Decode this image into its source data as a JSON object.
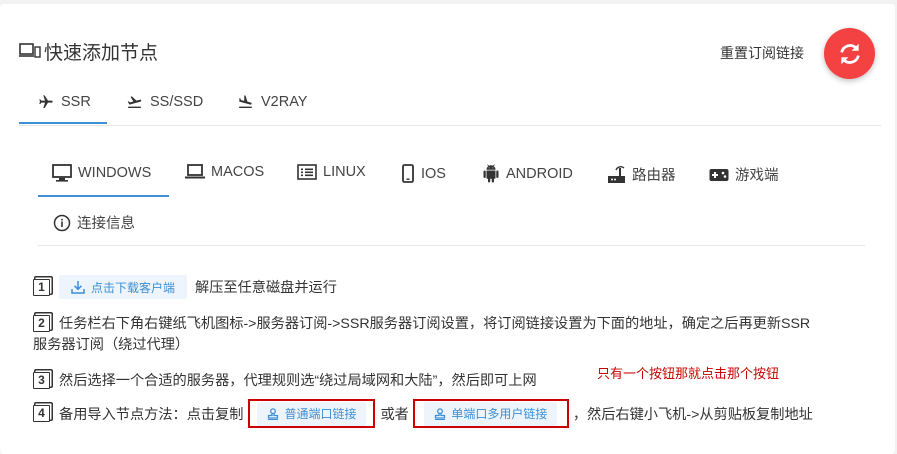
{
  "header": {
    "title": "快速添加节点",
    "reset_label": "重置订阅链接"
  },
  "protocol_tabs": [
    {
      "label": "SSR",
      "active": true
    },
    {
      "label": "SS/SSD",
      "active": false
    },
    {
      "label": "V2RAY",
      "active": false
    }
  ],
  "os_tabs": [
    {
      "label": "WINDOWS",
      "active": true
    },
    {
      "label": "MACOS",
      "active": false
    },
    {
      "label": "LINUX",
      "active": false
    },
    {
      "label": "IOS",
      "active": false
    },
    {
      "label": "ANDROID",
      "active": false
    },
    {
      "label": "路由器",
      "active": false
    },
    {
      "label": "游戏端",
      "active": false
    },
    {
      "label": "连接信息",
      "active": false
    }
  ],
  "steps": {
    "s1_num": "1",
    "s1_button": "点击下载客户端",
    "s1_text": "解压至任意磁盘并运行",
    "s2_num": "2",
    "s2_line1": "任务栏右下角右键纸飞机图标->服务器订阅->SSR服务器订阅设置，将订阅链接设置为下面的地址，确定之后再更新SSR",
    "s2_line2": "服务器订阅（绕过代理）",
    "s3_num": "3",
    "s3_text": "然后选择一个合适的服务器，代理规则选“绕过局域网和大陆”，然后即可上网",
    "s4_num": "4",
    "s4_prefix": "备用导入节点方法：点击复制",
    "s4_btn1": "普通端口链接",
    "s4_or": "或者",
    "s4_btn2": "单端口多用户链接",
    "s4_suffix": "，然后右键小飞机->从剪贴板复制地址"
  },
  "annotation": "只有一个按钮那就点击那个按钮",
  "colors": {
    "accent": "#3d8fd6",
    "reset_button": "#f44242",
    "annotation": "#cc0000"
  }
}
